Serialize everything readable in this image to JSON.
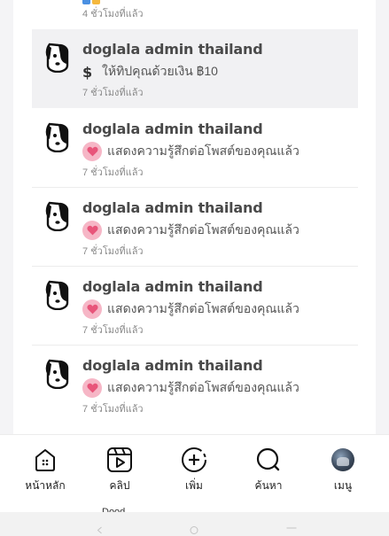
{
  "top_partial": {
    "time": "4 ชั่วโมงที่แล้ว"
  },
  "notifications": [
    {
      "name": "doglala admin thailand",
      "icon": "dollar-icon",
      "message": "ให้ทิปคุณด้วยเงิน ฿10",
      "time": "7 ชั่วโมงที่แล้ว",
      "highlight": true
    },
    {
      "name": "doglala admin thailand",
      "icon": "heart-icon",
      "message": "แสดงความรู้สึกต่อโพสต์ของคุณแล้ว",
      "time": "7 ชั่วโมงที่แล้ว",
      "highlight": false
    },
    {
      "name": "doglala admin thailand",
      "icon": "heart-icon",
      "message": "แสดงความรู้สึกต่อโพสต์ของคุณแล้ว",
      "time": "7 ชั่วโมงที่แล้ว",
      "highlight": false
    },
    {
      "name": "doglala admin thailand",
      "icon": "heart-icon",
      "message": "แสดงความรู้สึกต่อโพสต์ของคุณแล้ว",
      "time": "7 ชั่วโมงที่แล้ว",
      "highlight": false
    },
    {
      "name": "doglala admin thailand",
      "icon": "heart-icon",
      "message": "แสดงความรู้สึกต่อโพสต์ของคุณแล้ว",
      "time": "7 ชั่วโมงที่แล้ว",
      "highlight": false
    }
  ],
  "nav": {
    "home": "หน้าหลัก",
    "clips": "คลิป",
    "add": "เพิ่ม",
    "search": "ค้นหา",
    "menu": "เมนู"
  },
  "colors": {
    "heart_bg": "#f6b6c6",
    "heart": "#e8557a",
    "highlight_row": "#f1f1f3"
  },
  "cut_text": "Dood"
}
